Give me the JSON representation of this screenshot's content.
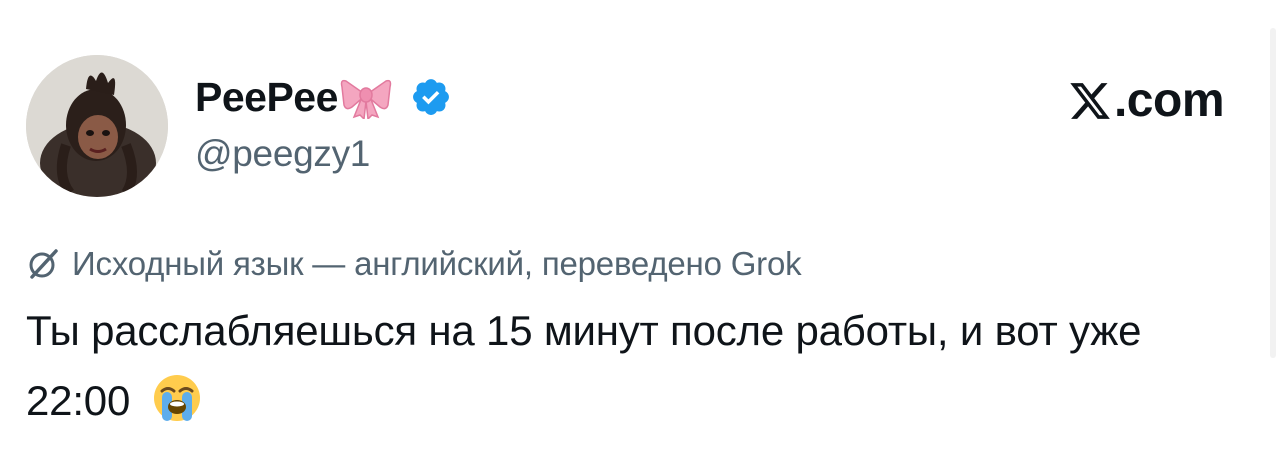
{
  "author": {
    "display_name": "PeePee",
    "handle": "@peegzy1",
    "verified": true,
    "name_emoji": "ribbon-bow-icon",
    "avatar": "avatar-photo"
  },
  "brand": {
    "label": ".com",
    "logo": "x-logo-icon"
  },
  "translation": {
    "icon": "grok-icon",
    "label": "Исходный язык — английский, переведено Grok"
  },
  "tweet": {
    "text": "Ты расслабляешься на 15 минут после работы, и вот уже 22:00",
    "emoji": "loudly-crying-face-icon"
  },
  "colors": {
    "primary_text": "#0f1419",
    "secondary_text": "#536471",
    "verified_blue": "#1d9bf0",
    "bow_pink": "#f4a6c0"
  }
}
